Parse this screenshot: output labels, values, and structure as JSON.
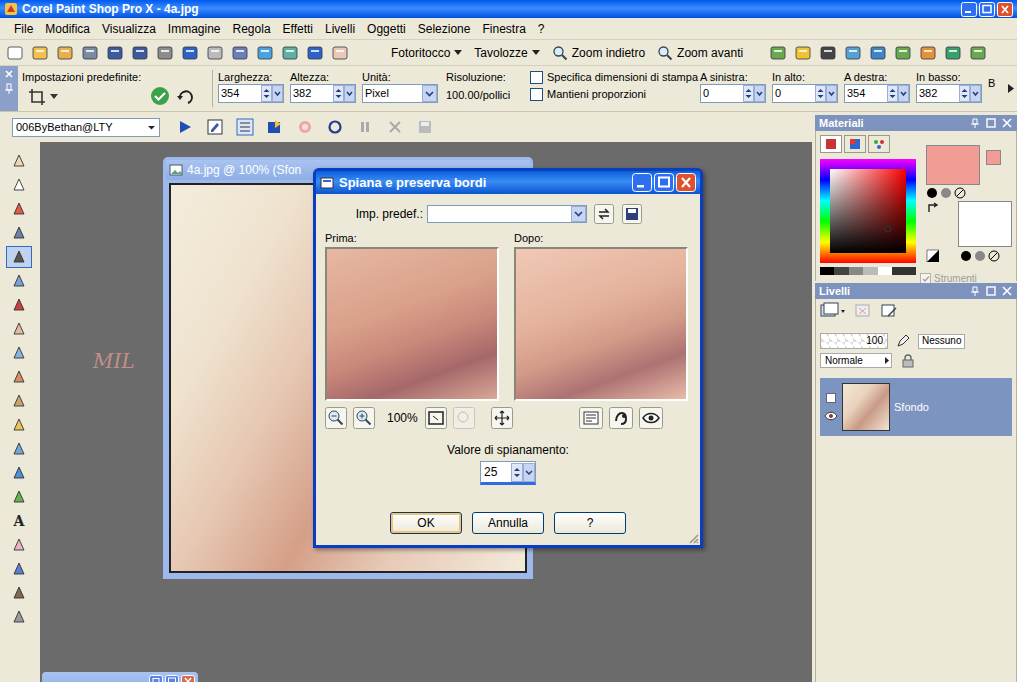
{
  "window": {
    "title": "Corel Paint Shop Pro X - 4a.jpg"
  },
  "menu": [
    "File",
    "Modifica",
    "Visualizza",
    "Immagine",
    "Regola",
    "Effetti",
    "Livelli",
    "Oggetti",
    "Selezione",
    "Finestra",
    "?"
  ],
  "toolbar": {
    "buttons": [
      {
        "label": "Fotoritocco",
        "dropdown": true
      },
      {
        "label": "Tavolozze",
        "dropdown": true
      },
      {
        "label": "Zoom indietro",
        "dropdown": false
      },
      {
        "label": "Zoom avanti",
        "dropdown": false
      }
    ]
  },
  "tool_options": {
    "preset_label": "Impostazioni predefinite:",
    "size_fields": [
      {
        "label": "Larghezza:",
        "value": "354"
      },
      {
        "label": "Altezza:",
        "value": "382"
      }
    ],
    "unit": {
      "label": "Unità:",
      "value": "Pixel"
    },
    "resolution": {
      "label": "Risoluzione:",
      "value": "100.00/pollici"
    },
    "checkboxes": [
      {
        "label": "Specifica dimensioni di stampa",
        "checked": false
      },
      {
        "label": "Mantieni proporzioni",
        "checked": false
      }
    ],
    "margin_fields": [
      {
        "label": "A sinistra:",
        "value": "0"
      },
      {
        "label": "In alto:",
        "value": "0"
      },
      {
        "label": "A destra:",
        "value": "354"
      },
      {
        "label": "In basso:",
        "value": "382"
      }
    ],
    "cut_label": "B"
  },
  "script_bar": {
    "script": "006ByBethan@LTY"
  },
  "tools": [
    {
      "kind": "icon",
      "selected": false
    },
    {
      "kind": "icon",
      "selected": false
    },
    {
      "kind": "icon",
      "selected": false
    },
    {
      "kind": "icon",
      "selected": false
    },
    {
      "kind": "icon",
      "selected": true
    },
    {
      "kind": "icon",
      "selected": false
    },
    {
      "kind": "icon",
      "selected": false
    },
    {
      "kind": "icon",
      "selected": false
    },
    {
      "kind": "icon",
      "selected": false
    },
    {
      "kind": "icon",
      "selected": false
    },
    {
      "kind": "icon",
      "selected": false
    },
    {
      "kind": "icon",
      "selected": false
    },
    {
      "kind": "icon",
      "selected": false
    },
    {
      "kind": "icon",
      "selected": false
    },
    {
      "kind": "icon",
      "selected": false
    },
    {
      "kind": "glyph",
      "label": "A",
      "selected": false
    },
    {
      "kind": "icon",
      "selected": false
    },
    {
      "kind": "icon",
      "selected": false
    },
    {
      "kind": "icon",
      "selected": false
    },
    {
      "kind": "icon",
      "selected": false
    }
  ],
  "image_window": {
    "title": "4a.jpg @ 100% (Sfon"
  },
  "watermark": "MIL",
  "dialog": {
    "title": "Spiana e preserva bordi",
    "preset_label": "Imp. predef.:",
    "before_label": "Prima:",
    "after_label": "Dopo:",
    "zoom": "100%",
    "amount_label": "Valore di spianamento:",
    "amount": "25",
    "buttons": [
      {
        "label": "OK",
        "default": true
      },
      {
        "label": "Annulla",
        "default": false
      },
      {
        "label": "?",
        "default": false
      }
    ]
  },
  "materials": {
    "title": "Materiali",
    "texture_label": "Strumenti",
    "texture_checked": true
  },
  "layers": {
    "title": "Livelli",
    "opacity": "100",
    "mask": "Nessuno",
    "blend": "Normale",
    "items": [
      {
        "name": "Sfondo",
        "selected": true,
        "visible": true
      }
    ]
  }
}
